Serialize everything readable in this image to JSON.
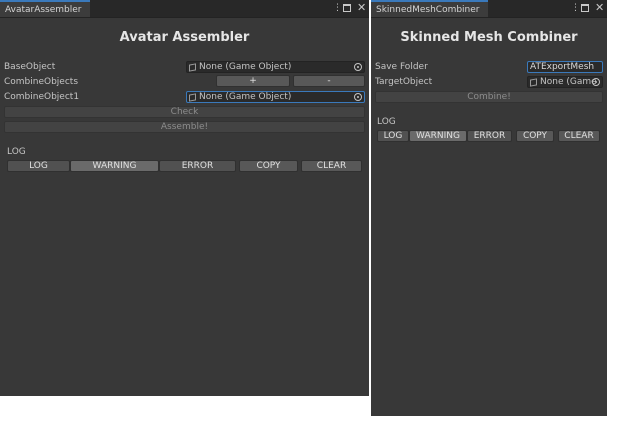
{
  "left_window": {
    "tab_label": "AvatarAssembler",
    "title": "Avatar Assembler",
    "base_object_label": "BaseObject",
    "base_object_value": "None (Game Object)",
    "combine_objects_label": "CombineObjects",
    "add_label": "+",
    "remove_label": "-",
    "combine_object1_label": "CombineObject1",
    "combine_object1_value": "None (Game Object)",
    "check_label": "Check",
    "assemble_label": "Assemble!",
    "log_heading": "LOG",
    "filters": {
      "log": "LOG",
      "warning": "WARNING",
      "error": "ERROR"
    },
    "copy_label": "COPY",
    "clear_label": "CLEAR"
  },
  "right_window": {
    "tab_label": "SkinnedMeshCombiner",
    "title": "Skinned Mesh Combiner",
    "save_folder_label": "Save Folder",
    "save_folder_value": "ATExportMesh",
    "target_object_label": "TargetObject",
    "target_object_value": "None (Game",
    "combine_label": "Combine!",
    "log_heading": "LOG",
    "filters": {
      "log": "LOG",
      "warning": "WARNING",
      "error": "ERROR"
    },
    "copy_label": "COPY",
    "clear_label": "CLEAR"
  },
  "window_controls": {
    "menu": "⋮",
    "close": "✕"
  },
  "colors": {
    "panel_bg": "#383838",
    "tab_accent": "#3a79bb",
    "field_bg": "#2a2a2a",
    "button_bg": "#585858"
  }
}
